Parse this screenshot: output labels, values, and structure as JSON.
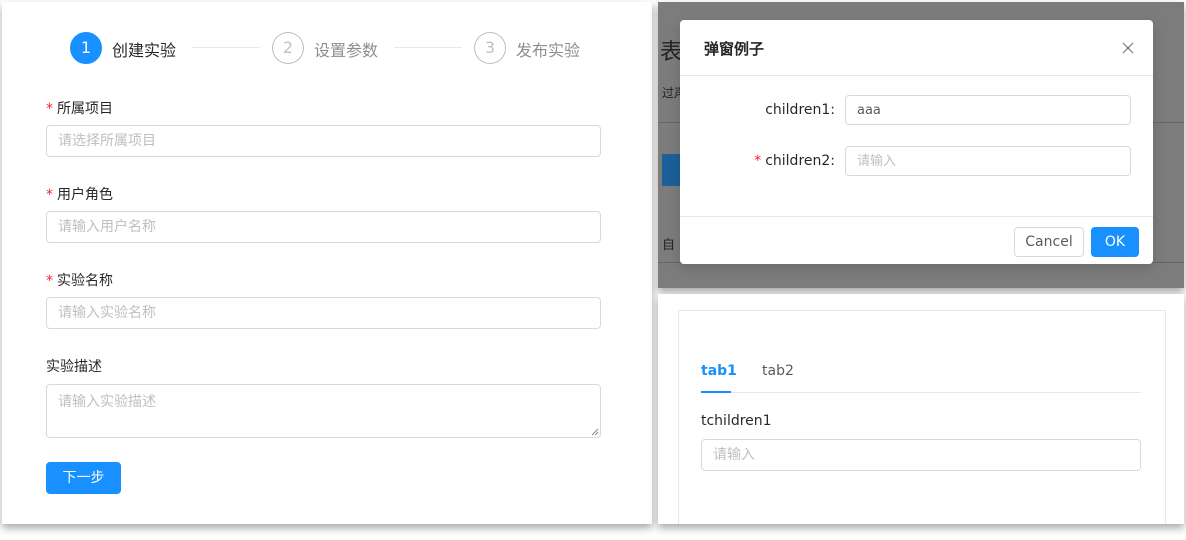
{
  "wizard": {
    "steps": [
      {
        "number": "1",
        "title": "创建实验",
        "status": "active"
      },
      {
        "number": "2",
        "title": "设置参数",
        "status": "wait"
      },
      {
        "number": "3",
        "title": "发布实验",
        "status": "wait"
      }
    ],
    "fields": [
      {
        "label": "所属项目",
        "required": true,
        "placeholder": "请选择所属项目"
      },
      {
        "label": "用户角色",
        "required": true,
        "placeholder": "请输入用户名称"
      },
      {
        "label": "实验名称",
        "required": true,
        "placeholder": "请输入实验名称"
      },
      {
        "label": "实验描述",
        "required": false,
        "placeholder": "请输入实验描述"
      }
    ],
    "required_mark": "*",
    "next_button": "下一步"
  },
  "modal_page": {
    "bg_title_char": "表",
    "bg_subtitle_char": "过声",
    "bg_footer_char": "自"
  },
  "modal": {
    "title": "弹窗例子",
    "fields": [
      {
        "label": "children1",
        "colon": ":",
        "required": false,
        "value": "aaa",
        "placeholder": ""
      },
      {
        "label": "children2",
        "colon": ":",
        "required": true,
        "value": "",
        "placeholder": "请输入"
      }
    ],
    "required_mark": "*",
    "cancel_button": "Cancel",
    "ok_button": "OK",
    "close_icon": "close-icon"
  },
  "tabs_card": {
    "tabs": [
      {
        "label": "tab1",
        "active": true
      },
      {
        "label": "tab2",
        "active": false
      }
    ],
    "field_label": "tchildren1",
    "field_placeholder": "请输入"
  },
  "colors": {
    "primary": "#1890ff",
    "required": "#f5222d",
    "mask": "#7c7c7c"
  }
}
